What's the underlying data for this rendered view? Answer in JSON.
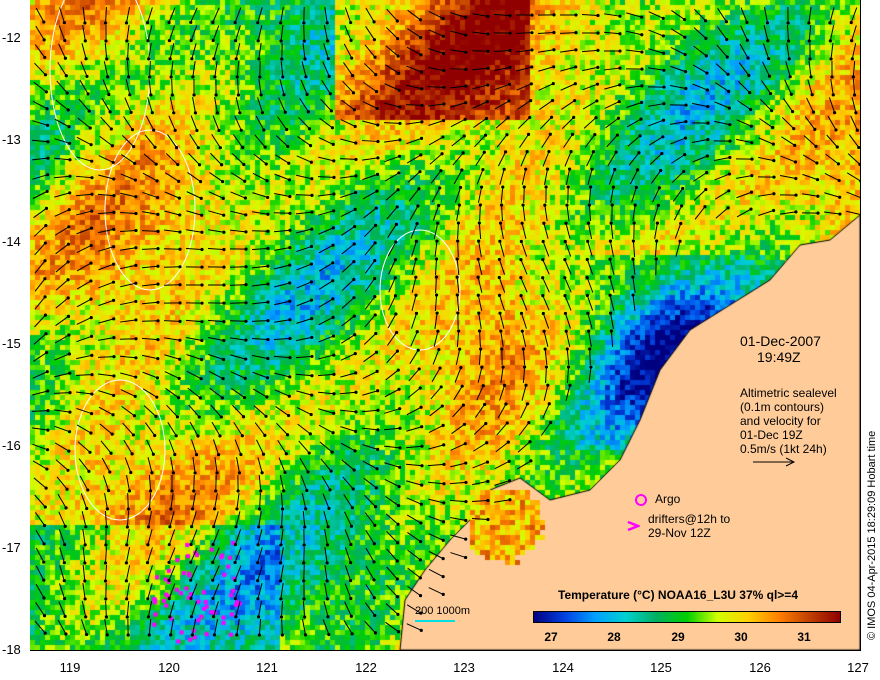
{
  "map": {
    "lon_ticks": [
      "119",
      "120",
      "121",
      "122",
      "123",
      "124",
      "125",
      "126",
      "127"
    ],
    "lat_ticks": [
      "-12",
      "-13",
      "-14",
      "-15",
      "-16",
      "-17",
      "-18"
    ],
    "land_color": "#ffcc99",
    "date": "01-Dec-2007",
    "time": "19:49Z",
    "altimetry_note": "Altimetric sealevel\n(0.1m contours)\nand velocity for\n01-Dec 19Z\n0.5m/s (1kt 24h)",
    "argo_label": "Argo",
    "drifters_label": "drifters@12h to\n29-Nov 12Z",
    "marker_color": "#ff00ff",
    "scale_label": "200  1000m",
    "credit": "© IMOS 04-Apr-2015 18:29:09 Hobart time"
  },
  "colorbar": {
    "title": "Temperature (°C) NOAA16_L3U 37% ql>=4",
    "ticks": [
      "27",
      "28",
      "29",
      "30",
      "31"
    ],
    "range": [
      26.7,
      31.6
    ]
  }
}
